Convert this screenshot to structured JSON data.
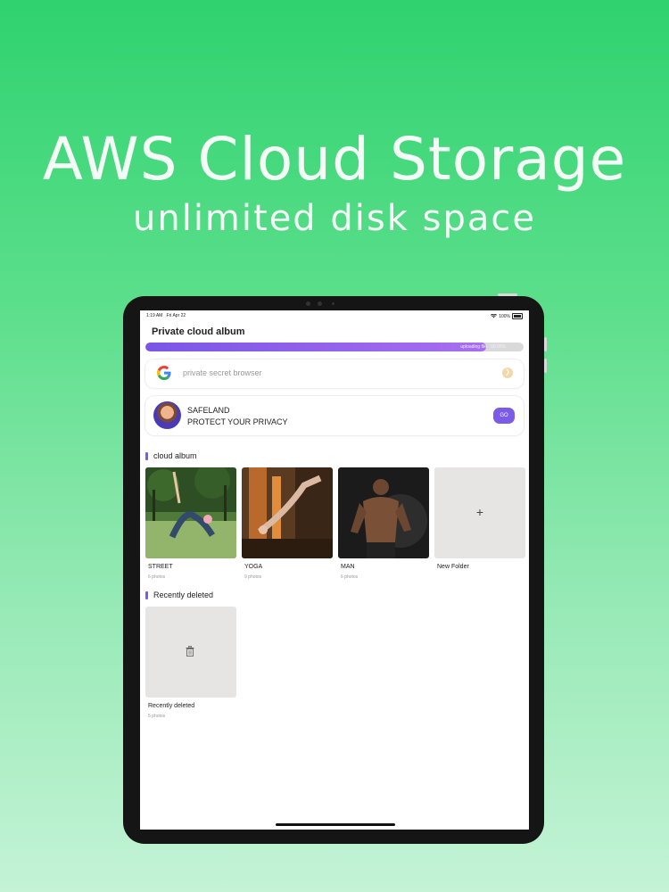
{
  "hero": {
    "title": "AWS Cloud Storage",
    "subtitle": "unlimited disk space"
  },
  "status_bar": {
    "time": "1:19 AM",
    "date": "Fri Apr 22",
    "battery": "100%"
  },
  "app": {
    "title": "Private cloud album",
    "upload": {
      "label": "uploading file",
      "percent_text": "90.00%",
      "progress": 0.9
    },
    "search_card": {
      "logo": "google-icon",
      "placeholder": "private secret browser",
      "go_icon": "arrow-right-circle-icon"
    },
    "promo": {
      "line1": "SAFELAND",
      "line2": "PROTECT YOUR PRIVACY",
      "button": "GO"
    },
    "cloud_album": {
      "heading": "cloud album",
      "items": [
        {
          "name": "STREET",
          "count": "6 photos"
        },
        {
          "name": "YOGA",
          "count": "9 photos"
        },
        {
          "name": "MAN",
          "count": "6 photos"
        },
        {
          "name": "New Folder",
          "count": ""
        }
      ]
    },
    "recently_deleted": {
      "heading": "Recently deleted",
      "items": [
        {
          "name": "Recently deleted",
          "count": "5 photos"
        }
      ]
    }
  },
  "colors": {
    "accent": "#7b5be8",
    "background_top": "#2fd26f",
    "background_bottom": "#c4f3d6"
  }
}
